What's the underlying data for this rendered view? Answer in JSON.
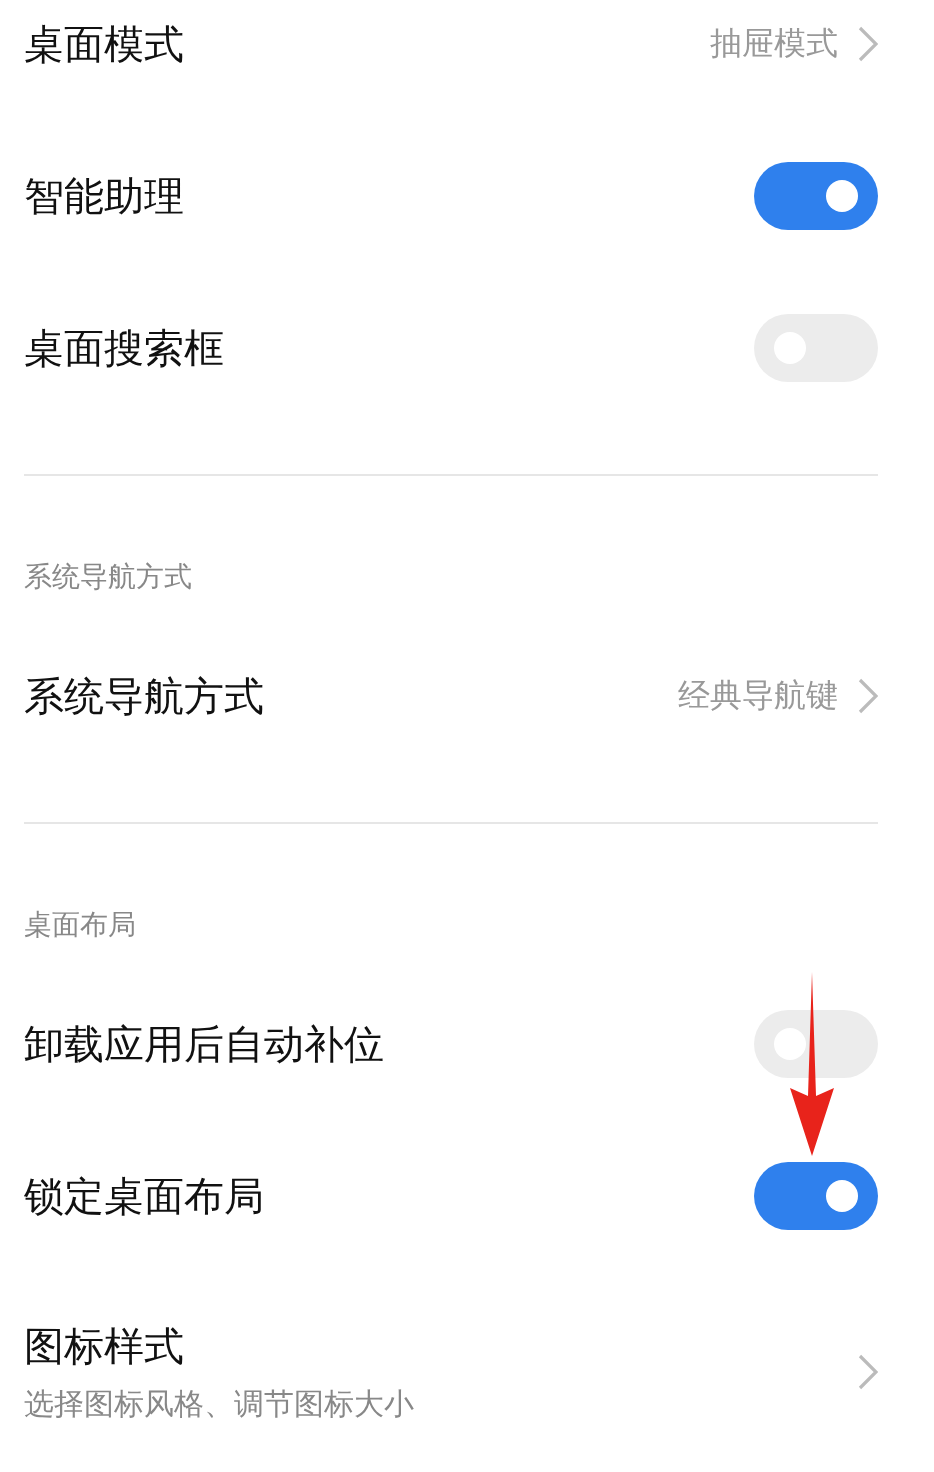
{
  "sections": [
    {
      "items": [
        {
          "kind": "link",
          "title": "桌面模式",
          "value": "抽屉模式"
        },
        {
          "kind": "toggle",
          "title": "智能助理",
          "on": true
        },
        {
          "kind": "toggle",
          "title": "桌面搜索框",
          "on": false
        }
      ]
    },
    {
      "header": "系统导航方式",
      "items": [
        {
          "kind": "link",
          "title": "系统导航方式",
          "value": "经典导航键"
        }
      ]
    },
    {
      "header": "桌面布局",
      "items": [
        {
          "kind": "toggle",
          "title": "卸载应用后自动补位",
          "on": false
        },
        {
          "kind": "toggle",
          "title": "锁定桌面布局",
          "on": true
        },
        {
          "kind": "sublink",
          "title": "图标样式",
          "subtitle": "选择图标风格、调节图标大小"
        }
      ]
    }
  ]
}
